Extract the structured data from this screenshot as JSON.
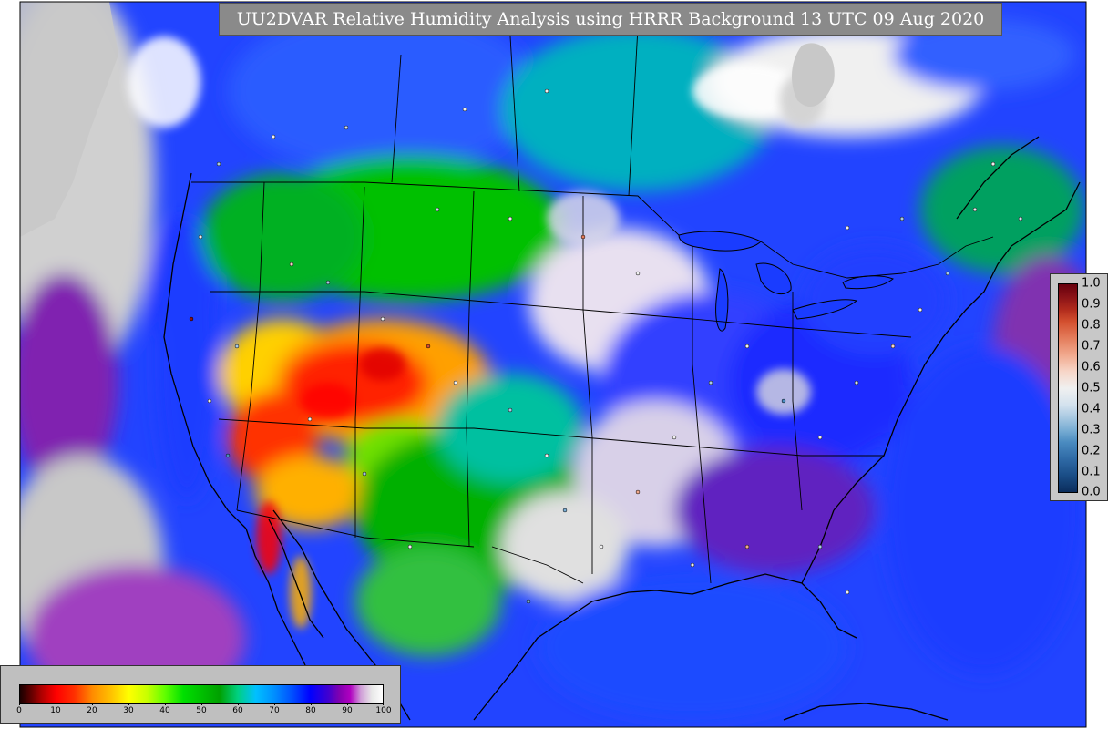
{
  "map": {
    "title": "UU2DVAR Relative Humidity Analysis using HRRR Background 13 UTC 09 Aug 2020",
    "field_colorbar": {
      "ticks": [
        "0",
        "10",
        "20",
        "30",
        "40",
        "50",
        "60",
        "70",
        "80",
        "90",
        "100"
      ]
    },
    "station_colorbar": {
      "ticks": [
        "1.0",
        "0.9",
        "0.8",
        "0.7",
        "0.6",
        "0.5",
        "0.4",
        "0.3",
        "0.2",
        "0.1",
        "0.0"
      ]
    },
    "colors": {
      "land_no_data": "#c8c8c8",
      "ocean_humid": "#1e3cff",
      "dry_core": "#ff0000",
      "moderate": "#00c000",
      "saturated": "#ffffff",
      "high_humidity": "#8000b0"
    }
  }
}
